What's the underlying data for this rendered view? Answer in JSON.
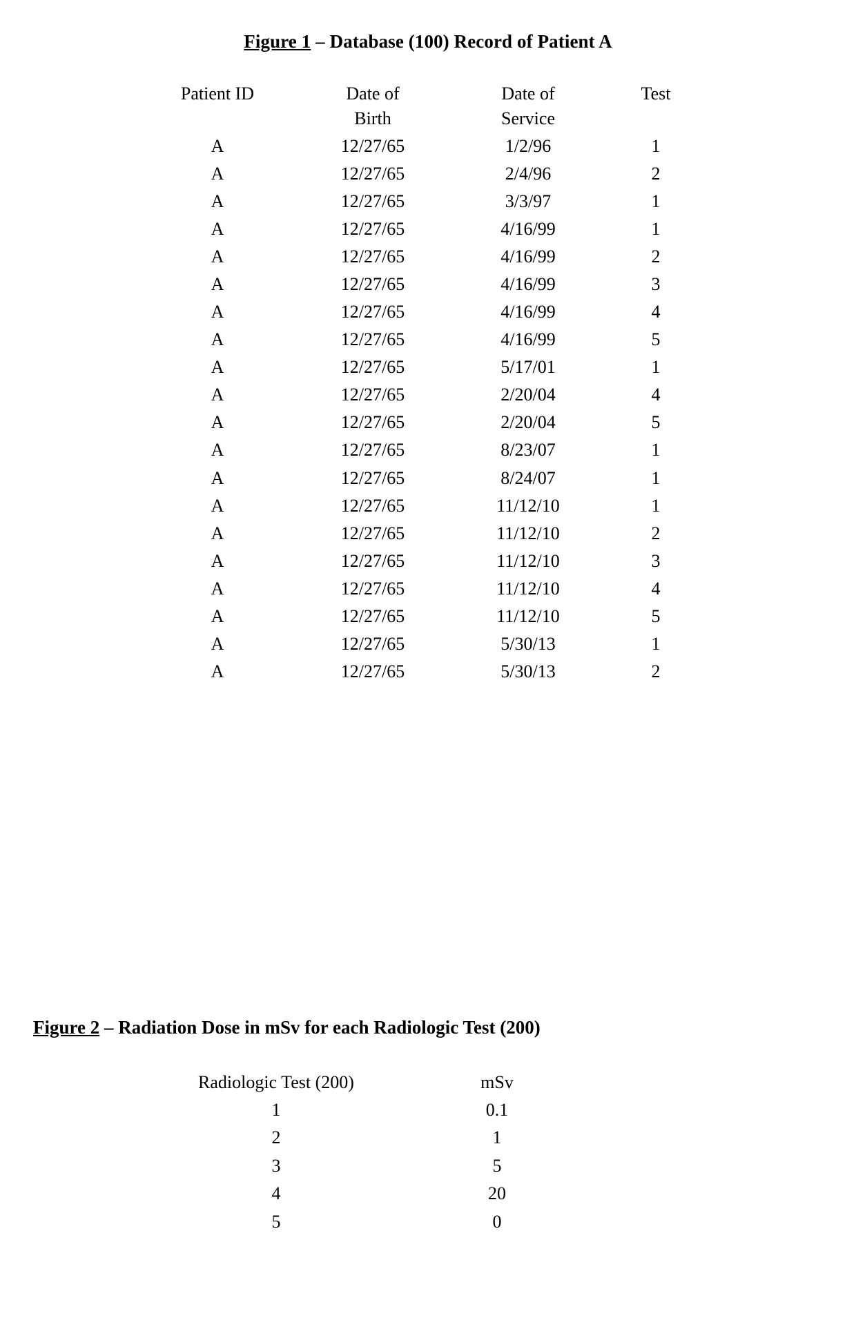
{
  "figure1": {
    "title_label": "Figure 1",
    "title_rest": " – Database (100) Record of Patient A",
    "columns": [
      "Patient ID",
      "Date of Birth",
      "Date of Service",
      "Test"
    ],
    "column_header_id": "Patient ID",
    "column_header_dob": "Date of Birth",
    "column_header_dos": "Date of Service",
    "column_header_test": "Test",
    "rows": [
      {
        "patient_id": "A",
        "dob": "12/27/65",
        "dos": "1/2/96",
        "test": "1"
      },
      {
        "patient_id": "A",
        "dob": "12/27/65",
        "dos": "2/4/96",
        "test": "2"
      },
      {
        "patient_id": "A",
        "dob": "12/27/65",
        "dos": "3/3/97",
        "test": "1"
      },
      {
        "patient_id": "A",
        "dob": "12/27/65",
        "dos": "4/16/99",
        "test": "1"
      },
      {
        "patient_id": "A",
        "dob": "12/27/65",
        "dos": "4/16/99",
        "test": "2"
      },
      {
        "patient_id": "A",
        "dob": "12/27/65",
        "dos": "4/16/99",
        "test": "3"
      },
      {
        "patient_id": "A",
        "dob": "12/27/65",
        "dos": "4/16/99",
        "test": "4"
      },
      {
        "patient_id": "A",
        "dob": "12/27/65",
        "dos": "4/16/99",
        "test": "5"
      },
      {
        "patient_id": "A",
        "dob": "12/27/65",
        "dos": "5/17/01",
        "test": "1"
      },
      {
        "patient_id": "A",
        "dob": "12/27/65",
        "dos": "2/20/04",
        "test": "4"
      },
      {
        "patient_id": "A",
        "dob": "12/27/65",
        "dos": "2/20/04",
        "test": "5"
      },
      {
        "patient_id": "A",
        "dob": "12/27/65",
        "dos": "8/23/07",
        "test": "1"
      },
      {
        "patient_id": "A",
        "dob": "12/27/65",
        "dos": "8/24/07",
        "test": "1"
      },
      {
        "patient_id": "A",
        "dob": "12/27/65",
        "dos": "11/12/10",
        "test": "1"
      },
      {
        "patient_id": "A",
        "dob": "12/27/65",
        "dos": "11/12/10",
        "test": "2"
      },
      {
        "patient_id": "A",
        "dob": "12/27/65",
        "dos": "11/12/10",
        "test": "3"
      },
      {
        "patient_id": "A",
        "dob": "12/27/65",
        "dos": "11/12/10",
        "test": "4"
      },
      {
        "patient_id": "A",
        "dob": "12/27/65",
        "dos": "11/12/10",
        "test": "5"
      },
      {
        "patient_id": "A",
        "dob": "12/27/65",
        "dos": "5/30/13",
        "test": "1"
      },
      {
        "patient_id": "A",
        "dob": "12/27/65",
        "dos": "5/30/13",
        "test": "2"
      }
    ]
  },
  "figure2": {
    "title_label": "Figure 2",
    "title_rest": " – Radiation Dose in mSv for each Radiologic Test (200)",
    "column_header_test": "Radiologic Test (200)",
    "column_header_msv": "mSv",
    "rows": [
      {
        "test": "1",
        "msv": "0.1"
      },
      {
        "test": "2",
        "msv": "1"
      },
      {
        "test": "3",
        "msv": "5"
      },
      {
        "test": "4",
        "msv": "20"
      },
      {
        "test": "5",
        "msv": "0"
      }
    ]
  },
  "chart_data": {
    "type": "table",
    "title": "Figure 1 – Database (100) Record of Patient A",
    "columns": [
      "Patient ID",
      "Date of Birth",
      "Date of Service",
      "Test"
    ],
    "rows": [
      [
        "A",
        "12/27/65",
        "1/2/96",
        1
      ],
      [
        "A",
        "12/27/65",
        "2/4/96",
        2
      ],
      [
        "A",
        "12/27/65",
        "3/3/97",
        1
      ],
      [
        "A",
        "12/27/65",
        "4/16/99",
        1
      ],
      [
        "A",
        "12/27/65",
        "4/16/99",
        2
      ],
      [
        "A",
        "12/27/65",
        "4/16/99",
        3
      ],
      [
        "A",
        "12/27/65",
        "4/16/99",
        4
      ],
      [
        "A",
        "12/27/65",
        "4/16/99",
        5
      ],
      [
        "A",
        "12/27/65",
        "5/17/01",
        1
      ],
      [
        "A",
        "12/27/65",
        "2/20/04",
        4
      ],
      [
        "A",
        "12/27/65",
        "2/20/04",
        5
      ],
      [
        "A",
        "12/27/65",
        "8/23/07",
        1
      ],
      [
        "A",
        "12/27/65",
        "8/24/07",
        1
      ],
      [
        "A",
        "12/27/65",
        "11/12/10",
        1
      ],
      [
        "A",
        "12/27/65",
        "11/12/10",
        2
      ],
      [
        "A",
        "12/27/65",
        "11/12/10",
        3
      ],
      [
        "A",
        "12/27/65",
        "11/12/10",
        4
      ],
      [
        "A",
        "12/27/65",
        "11/12/10",
        5
      ],
      [
        "A",
        "12/27/65",
        "5/30/13",
        1
      ],
      [
        "A",
        "12/27/65",
        "5/30/13",
        2
      ]
    ],
    "secondary": {
      "type": "table",
      "title": "Figure 2 – Radiation Dose in mSv for each Radiologic Test (200)",
      "columns": [
        "Radiologic Test (200)",
        "mSv"
      ],
      "rows": [
        [
          1,
          0.1
        ],
        [
          2,
          1
        ],
        [
          3,
          5
        ],
        [
          4,
          20
        ],
        [
          5,
          0
        ]
      ]
    }
  }
}
